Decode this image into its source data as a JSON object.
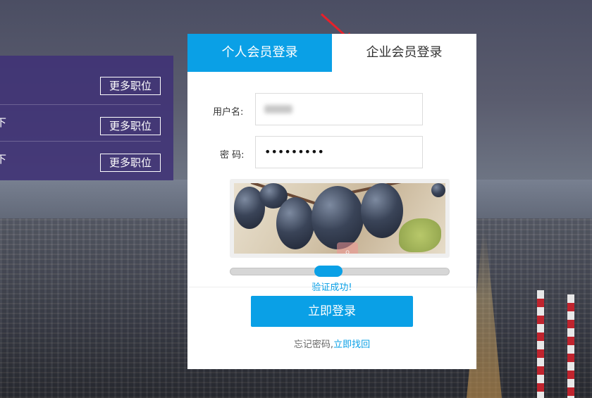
{
  "job_panel": {
    "rows": [
      {
        "cut_text": "",
        "more_label": "更多职位"
      },
      {
        "cut_text": "下",
        "more_label": "更多职位"
      },
      {
        "cut_text": "下",
        "more_label": "更多职位"
      }
    ]
  },
  "login": {
    "tabs": [
      {
        "label": "个人会员登录",
        "active": true
      },
      {
        "label": "企业会员登录",
        "active": false
      }
    ],
    "username_label": "用户名:",
    "password_label": "密  码:",
    "password_value": "•••••••••",
    "verify_status": "验证成功!",
    "submit_label": "立即登录",
    "forgot_prefix": "忘记密码,",
    "forgot_link": "立即找回"
  },
  "colors": {
    "accent": "#0aa0e6",
    "panel_bg": "#40327a"
  },
  "icons": {
    "captcha_puzzle": "puzzle-magnifier-icon",
    "annotation_arrow": "red-arrow-icon"
  }
}
